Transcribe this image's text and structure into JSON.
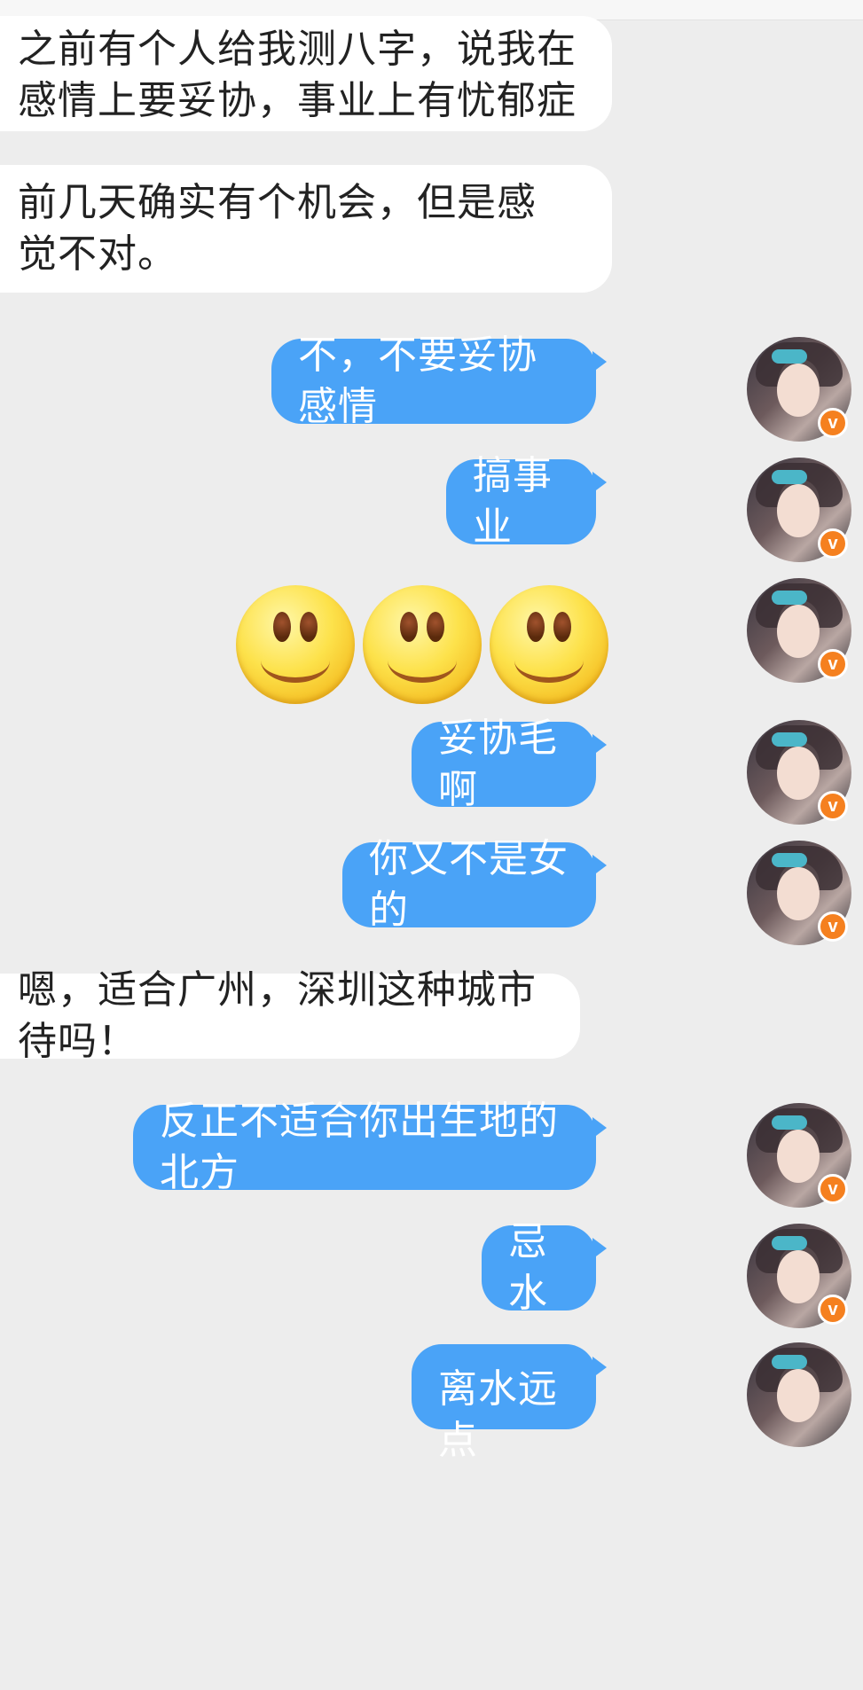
{
  "messages": [
    {
      "from": "other",
      "text": "之前有个人给我测八字，说我在感情上要妥协，事业上有忧郁症"
    },
    {
      "from": "other",
      "text": "前几天确实有个机会，但是感觉不对。"
    },
    {
      "from": "me",
      "text": "不，不要妥协感情"
    },
    {
      "from": "me",
      "text": "搞事业"
    },
    {
      "from": "me",
      "emoji": [
        "smile-emoji",
        "smile-emoji",
        "smile-emoji"
      ]
    },
    {
      "from": "me",
      "text": "妥协毛啊"
    },
    {
      "from": "me",
      "text": "你又不是女的"
    },
    {
      "from": "other",
      "text": "嗯，适合广州，深圳这种城市待吗！"
    },
    {
      "from": "me",
      "text": "反正不适合你出生地的北方"
    },
    {
      "from": "me",
      "text": "忌水"
    },
    {
      "from": "me",
      "text": "离水远点"
    }
  ],
  "me_avatar": {
    "badge": "v",
    "badge_color": "#f5801f"
  },
  "colors": {
    "background": "#ededed",
    "bubble_in": "#ffffff",
    "bubble_out": "#4aa3f7"
  }
}
